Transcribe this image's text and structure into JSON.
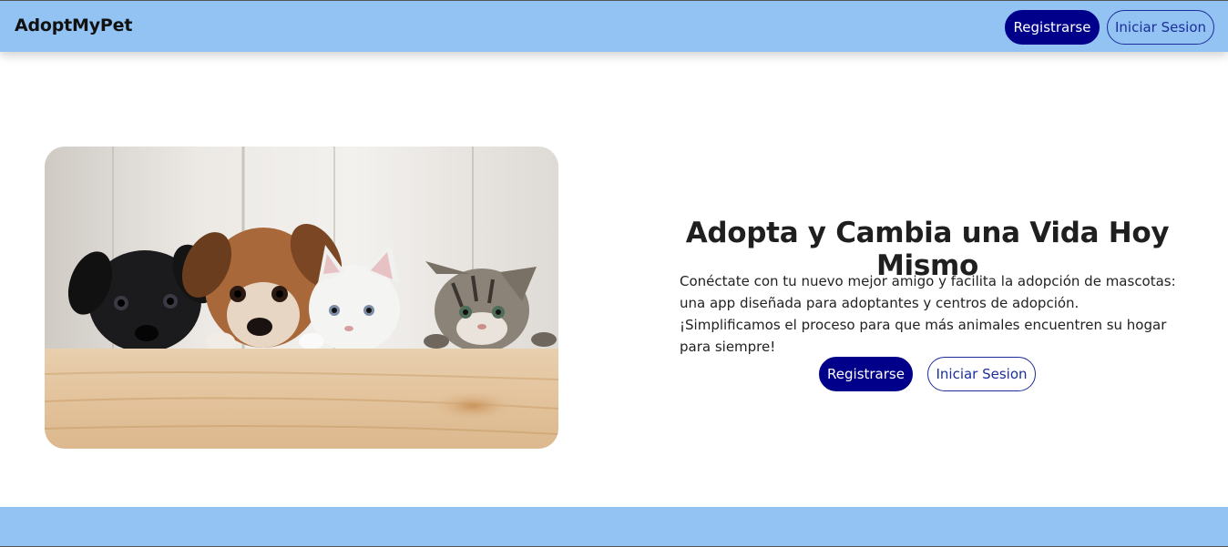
{
  "navbar": {
    "brand": "AdoptMyPet",
    "register_label": "Registrarse",
    "login_label": "Iniciar Sesion"
  },
  "hero": {
    "image_icon": "pets-photo",
    "title": "Adopta y Cambia una Vida Hoy Mismo",
    "description": "Conéctate con tu nuevo mejor amigo y facilita la adopción de mascotas: una app diseñada para adoptantes y centros de adopción. ¡Simplificamos el proceso para que más animales encuentren su hogar para siempre!",
    "register_label": "Registrarse",
    "login_label": "Iniciar Sesion"
  },
  "colors": {
    "navbar_bg": "#93c3f3",
    "primary_button": "#00008b",
    "outline_button": "#1c2e9a",
    "footer_bg": "#93c3f3"
  }
}
